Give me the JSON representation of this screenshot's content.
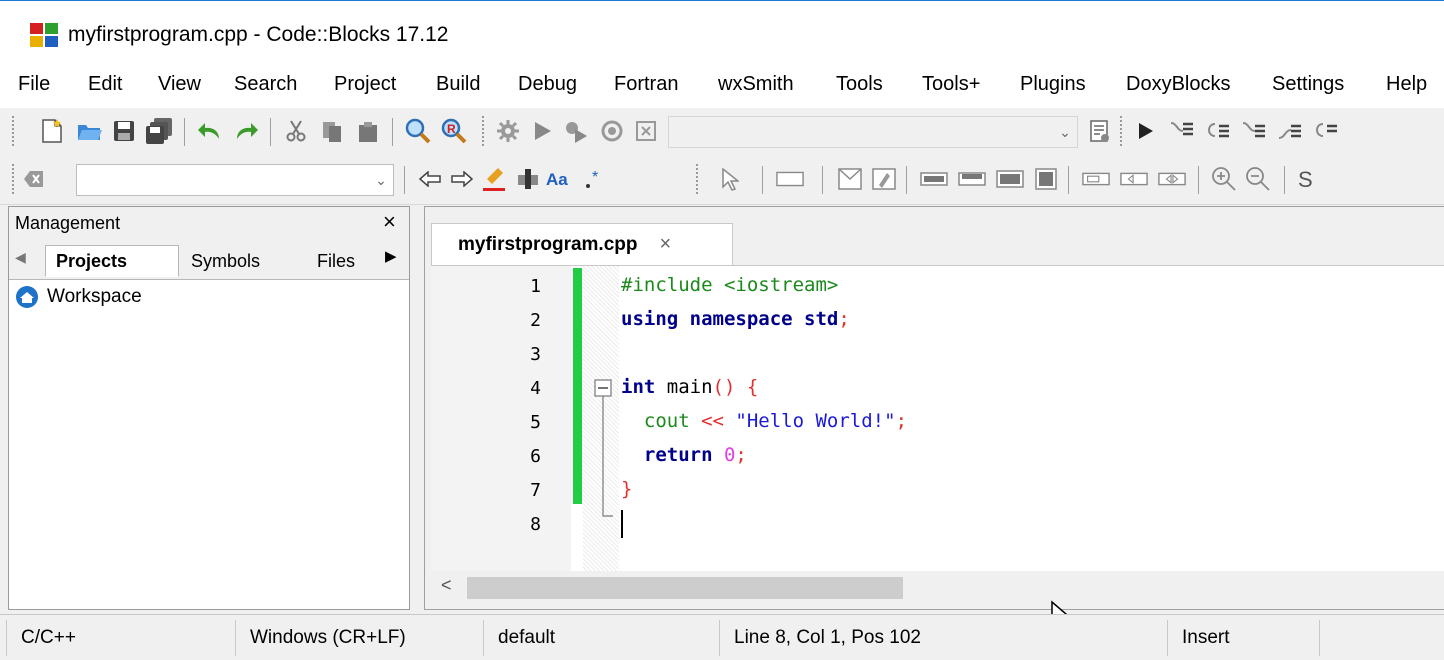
{
  "window": {
    "title": "myfirstprogram.cpp - Code::Blocks 17.12"
  },
  "menu": [
    "File",
    "Edit",
    "View",
    "Search",
    "Project",
    "Build",
    "Debug",
    "Fortran",
    "wxSmith",
    "Tools",
    "Tools+",
    "Plugins",
    "DoxyBlocks",
    "Settings",
    "Help"
  ],
  "toolbar1": {
    "icons": [
      "new-file-icon",
      "open-file-icon",
      "save-icon",
      "save-all-icon",
      "undo-icon",
      "redo-icon",
      "cut-icon",
      "copy-icon",
      "paste-icon",
      "find-icon",
      "replace-icon",
      "build-icon",
      "run-icon",
      "build-run-icon",
      "rebuild-icon",
      "abort-icon"
    ],
    "target_combo_value": "",
    "debug_icons": [
      "debug-window-icon",
      "debug-continue-icon",
      "run-to-cursor-icon",
      "next-line-icon",
      "step-into-icon",
      "step-out-icon"
    ]
  },
  "toolbar2": {
    "search_combo_value": "",
    "icons": [
      "back-icon",
      "forward-icon",
      "highlight-icon",
      "selected-text-icon",
      "match-case-icon",
      "regex-icon",
      "select-icon",
      "panel-icon",
      "dialog-icon",
      "frame-icon",
      "horizontal-sizer-icon",
      "vertical-sizer-icon",
      "grid-sizer-icon",
      "box-sizer-icon",
      "static-box-icon",
      "button-icon",
      "checkbox-icon",
      "zoom-in-icon",
      "zoom-out-icon"
    ],
    "end_text": "S"
  },
  "management": {
    "title": "Management",
    "close_label": "×",
    "tabs": [
      {
        "label": "Projects",
        "active": true
      },
      {
        "label": "Symbols",
        "active": false
      },
      {
        "label": "Files",
        "active": false
      }
    ],
    "tree": {
      "root": "Workspace"
    }
  },
  "editor": {
    "tab": {
      "label": "myfirstprogram.cpp",
      "close": "×"
    },
    "line_numbers": [
      "1",
      "2",
      "3",
      "4",
      "5",
      "6",
      "7",
      "8"
    ],
    "lines": [
      [
        {
          "t": "#include <iostream>",
          "c": "pp"
        }
      ],
      [
        {
          "t": "using namespace std",
          "c": "kw"
        },
        {
          "t": ";",
          "c": "op"
        }
      ],
      [],
      [
        {
          "t": "int",
          "c": "kw"
        },
        {
          "t": " main",
          "c": "id"
        },
        {
          "t": "()",
          "c": "op"
        },
        {
          "t": " {",
          "c": "op"
        }
      ],
      [
        {
          "t": "  cout ",
          "c": "pp"
        },
        {
          "t": "<<",
          "c": "op"
        },
        {
          "t": " \"Hello World!\"",
          "c": "str"
        },
        {
          "t": ";",
          "c": "op"
        }
      ],
      [
        {
          "t": "  return ",
          "c": "kw"
        },
        {
          "t": "0",
          "c": "num"
        },
        {
          "t": ";",
          "c": "op"
        }
      ],
      [
        {
          "t": "}",
          "c": "op"
        }
      ],
      []
    ]
  },
  "status": {
    "language": "C/C++",
    "eol": "Windows (CR+LF)",
    "encoding": "default",
    "position": "Line 8, Col 1, Pos 102",
    "mode": "Insert"
  }
}
